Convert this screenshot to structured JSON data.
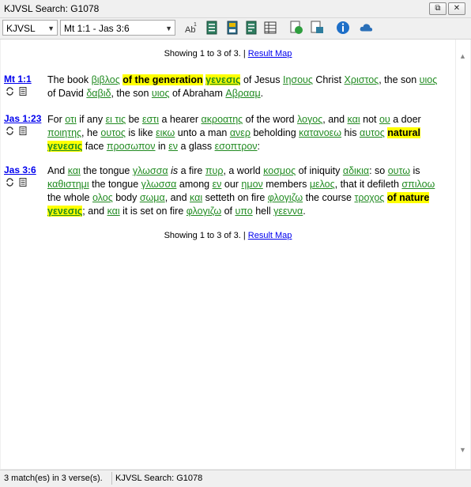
{
  "window": {
    "title": "KJVSL Search: G1078",
    "restore_glyph": "⧉",
    "close_glyph": "✕"
  },
  "toolbar": {
    "version_select": "KJVSL",
    "range_select": "Mt 1:1 - Jas 3:6",
    "icons": [
      "strongs-icon",
      "copy-verses-icon",
      "save-icon",
      "search-tree-icon",
      "table-icon",
      "globe-green-icon",
      "nt-icon",
      "info-icon",
      "cloud-icon"
    ]
  },
  "results": {
    "showing_top": "Showing 1 to 3 of 3.",
    "result_map": "Result Map",
    "separator": "|",
    "showing_bottom": "Showing 1 to 3 of 3.",
    "verses": [
      {
        "ref": "Mt 1:1",
        "segments": [
          {
            "t": "The book "
          },
          {
            "t": "βιβλος",
            "g": 1
          },
          {
            "t": " "
          },
          {
            "t": "of the generation",
            "h": 1
          },
          {
            "t": " "
          },
          {
            "t": "γενεσις",
            "g": 1,
            "h": 1
          },
          {
            "t": " of Jesus "
          },
          {
            "t": "Ιησους",
            "g": 1
          },
          {
            "t": " Christ "
          },
          {
            "t": "Χριστος",
            "g": 1
          },
          {
            "t": ", the son "
          },
          {
            "t": "υιος",
            "g": 1
          },
          {
            "t": " of David "
          },
          {
            "t": "δαβιδ",
            "g": 1
          },
          {
            "t": ", the son "
          },
          {
            "t": "υιος",
            "g": 1
          },
          {
            "t": " of Abraham "
          },
          {
            "t": "Αβρααμ",
            "g": 1
          },
          {
            "t": "."
          }
        ]
      },
      {
        "ref": "Jas 1:23",
        "segments": [
          {
            "t": "For "
          },
          {
            "t": "οτι",
            "g": 1
          },
          {
            "t": " if any "
          },
          {
            "t": "ει τις",
            "g": 1
          },
          {
            "t": " be "
          },
          {
            "t": "εστι",
            "g": 1
          },
          {
            "t": " a hearer "
          },
          {
            "t": "ακροατης",
            "g": 1
          },
          {
            "t": " of the word "
          },
          {
            "t": "λογος",
            "g": 1
          },
          {
            "t": ", and "
          },
          {
            "t": "και",
            "g": 1
          },
          {
            "t": " not "
          },
          {
            "t": "ου",
            "g": 1
          },
          {
            "t": " a doer "
          },
          {
            "t": "ποιητης",
            "g": 1
          },
          {
            "t": ", he "
          },
          {
            "t": "ουτος",
            "g": 1
          },
          {
            "t": " is like "
          },
          {
            "t": "εικω",
            "g": 1
          },
          {
            "t": " unto a man "
          },
          {
            "t": "ανερ",
            "g": 1
          },
          {
            "t": " beholding "
          },
          {
            "t": "κατανοεω",
            "g": 1
          },
          {
            "t": " his "
          },
          {
            "t": "αυτος",
            "g": 1
          },
          {
            "t": " "
          },
          {
            "t": "natural",
            "h": 1
          },
          {
            "t": " "
          },
          {
            "t": "γενεσις",
            "g": 1,
            "h": 1
          },
          {
            "t": " face "
          },
          {
            "t": "προσωπον",
            "g": 1
          },
          {
            "t": " in "
          },
          {
            "t": "εν",
            "g": 1
          },
          {
            "t": " a glass "
          },
          {
            "t": "εσοπτρον",
            "g": 1
          },
          {
            "t": ":"
          }
        ]
      },
      {
        "ref": "Jas 3:6",
        "segments": [
          {
            "t": "And "
          },
          {
            "t": "και",
            "g": 1
          },
          {
            "t": " the tongue "
          },
          {
            "t": "γλωσσα",
            "g": 1
          },
          {
            "t": " "
          },
          {
            "t": "is",
            "i": 1
          },
          {
            "t": " a fire "
          },
          {
            "t": "πυρ",
            "g": 1
          },
          {
            "t": ", a world "
          },
          {
            "t": "κοσμος",
            "g": 1
          },
          {
            "t": " of iniquity "
          },
          {
            "t": "αδικια",
            "g": 1
          },
          {
            "t": ": so "
          },
          {
            "t": "ουτω",
            "g": 1
          },
          {
            "t": " is "
          },
          {
            "t": "καθιστημι",
            "g": 1
          },
          {
            "t": " the tongue "
          },
          {
            "t": "γλωσσα",
            "g": 1
          },
          {
            "t": " among "
          },
          {
            "t": "εν",
            "g": 1
          },
          {
            "t": " our "
          },
          {
            "t": "ημον",
            "g": 1
          },
          {
            "t": " members "
          },
          {
            "t": "μελος",
            "g": 1
          },
          {
            "t": ", that it defileth "
          },
          {
            "t": "σπιλοω",
            "g": 1
          },
          {
            "t": " the whole "
          },
          {
            "t": "ολος",
            "g": 1
          },
          {
            "t": " body "
          },
          {
            "t": "σωμα",
            "g": 1
          },
          {
            "t": ", and "
          },
          {
            "t": "και",
            "g": 1
          },
          {
            "t": " setteth on fire "
          },
          {
            "t": "φλογιζω",
            "g": 1
          },
          {
            "t": " the course "
          },
          {
            "t": "τροχος",
            "g": 1
          },
          {
            "t": " "
          },
          {
            "t": "of nature",
            "h": 1
          },
          {
            "t": " "
          },
          {
            "t": "γενεσις",
            "g": 1,
            "h": 1
          },
          {
            "t": "; and "
          },
          {
            "t": "και",
            "g": 1
          },
          {
            "t": " it is set on fire "
          },
          {
            "t": "φλογιζω",
            "g": 1
          },
          {
            "t": " of "
          },
          {
            "t": "υπο",
            "g": 1
          },
          {
            "t": " hell "
          },
          {
            "t": "γεεννα",
            "g": 1
          },
          {
            "t": "."
          }
        ]
      }
    ]
  },
  "status": {
    "matches": "3 match(es) in 3 verse(s).",
    "search": "KJVSL Search: G1078"
  }
}
